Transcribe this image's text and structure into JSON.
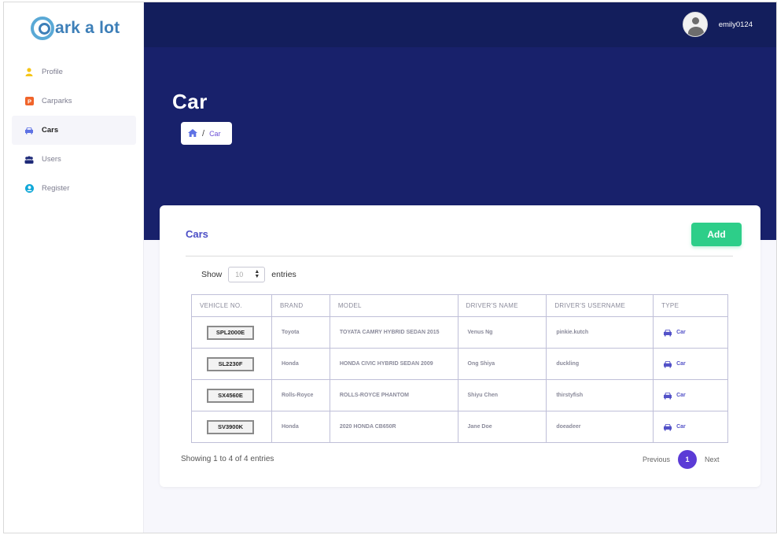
{
  "app": {
    "logo_text": "ark a lot"
  },
  "sidebar": {
    "items": [
      {
        "label": "Profile",
        "icon": "user-icon",
        "color": "#f5c518",
        "active": false
      },
      {
        "label": "Carparks",
        "icon": "parking-icon",
        "color": "#f0642a",
        "active": false
      },
      {
        "label": "Cars",
        "icon": "car-icon",
        "color": "#5e72e4",
        "active": true
      },
      {
        "label": "Users",
        "icon": "users-icon",
        "color": "#1e2a78",
        "active": false
      },
      {
        "label": "Register",
        "icon": "user-circle-icon",
        "color": "#11a8d8",
        "active": false
      }
    ]
  },
  "header": {
    "username": "emily0124"
  },
  "hero": {
    "title": "Car",
    "breadcrumb": {
      "current": "Car",
      "separator": "/"
    }
  },
  "card": {
    "title": "Cars",
    "add_label": "Add",
    "show_label": "Show",
    "entries_label": "entries",
    "entries_select": {
      "selected": "10"
    }
  },
  "table": {
    "columns": [
      "VEHICLE NO.",
      "BRAND",
      "MODEL",
      "DRIVER'S NAME",
      "DRIVER'S USERNAME",
      "TYPE"
    ],
    "rows": [
      {
        "vehicle": "SPL2000E",
        "brand": "Toyota",
        "model": "TOYATA CAMRY HYBRID SEDAN 2015",
        "driver": "Venus Ng",
        "username": "pinkie.kutch",
        "type": "Car"
      },
      {
        "vehicle": "SL2230F",
        "brand": "Honda",
        "model": "HONDA CIVIC HYBRID SEDAN 2009",
        "driver": "Ong Shiya",
        "username": "duckling",
        "type": "Car"
      },
      {
        "vehicle": "SX4560E",
        "brand": "Rolls-Royce",
        "model": "ROLLS-ROYCE PHANTOM",
        "driver": "Shiyu Chen",
        "username": "thirstyfish",
        "type": "Car"
      },
      {
        "vehicle": "SV3900K",
        "brand": "Honda",
        "model": "2020 HONDA CB650R",
        "driver": "Jane Doe",
        "username": "doeadeer",
        "type": "Car"
      }
    ]
  },
  "footer": {
    "info": "Showing 1 to 4 of 4 entries",
    "previous": "Previous",
    "current_page": "1",
    "next": "Next"
  },
  "colors": {
    "navy": "#131e5c",
    "hero": "#18216b",
    "accent": "#5b3bd6",
    "add_button": "#2dce89"
  }
}
